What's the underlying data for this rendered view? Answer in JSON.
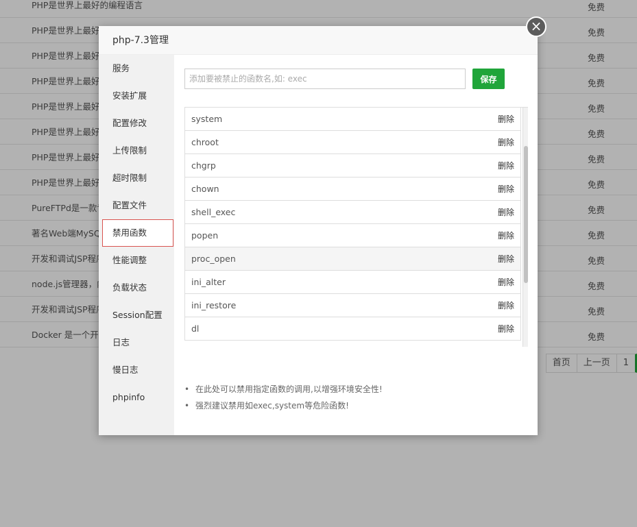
{
  "background": {
    "rows": [
      {
        "desc": "PHP是世界上最好的编程语言",
        "price": "免费"
      },
      {
        "desc": "PHP是世界上最好",
        "price": "免费"
      },
      {
        "desc": "PHP是世界上最好",
        "price": "免费"
      },
      {
        "desc": "PHP是世界上最好",
        "price": "免费"
      },
      {
        "desc": "PHP是世界上最好",
        "price": "免费"
      },
      {
        "desc": "PHP是世界上最好",
        "price": "免费"
      },
      {
        "desc": "PHP是世界上最好",
        "price": "免费"
      },
      {
        "desc": "PHP是世界上最好",
        "price": "免费"
      },
      {
        "desc": "PureFTPd是一款专",
        "price": "免费"
      },
      {
        "desc": "著名Web端MySQ",
        "price": "免费"
      },
      {
        "desc": "开发和调试JSP程序",
        "price": "免费"
      },
      {
        "desc": "node.js管理器，内",
        "price": "免费"
      },
      {
        "desc": "开发和调试JSP程序",
        "price": "免费"
      },
      {
        "desc": "Docker 是一个开源",
        "price": "免费"
      }
    ],
    "pager": {
      "first": "首页",
      "prev": "上一页",
      "current": "1"
    }
  },
  "modal": {
    "title": "php-7.3管理",
    "close_icon": "×",
    "sidebar": [
      "服务",
      "安装扩展",
      "配置修改",
      "上传限制",
      "超时限制",
      "配置文件",
      "禁用函数",
      "性能调整",
      "负载状态",
      "Session配置",
      "日志",
      "慢日志",
      "phpinfo"
    ],
    "active_index": 6,
    "input_placeholder": "添加要被禁止的函数名,如: exec",
    "save_label": "保存",
    "delete_label": "删除",
    "functions": [
      "system",
      "chroot",
      "chgrp",
      "chown",
      "shell_exec",
      "popen",
      "proc_open",
      "ini_alter",
      "ini_restore",
      "dl"
    ],
    "highlighted_function": "proc_open",
    "tips": [
      "在此处可以禁用指定函数的调用,以增强环境安全性!",
      "强烈建议禁用如exec,system等危险函数!"
    ]
  },
  "colors": {
    "accent": "#20a53a",
    "active_border": "#d9534f"
  }
}
